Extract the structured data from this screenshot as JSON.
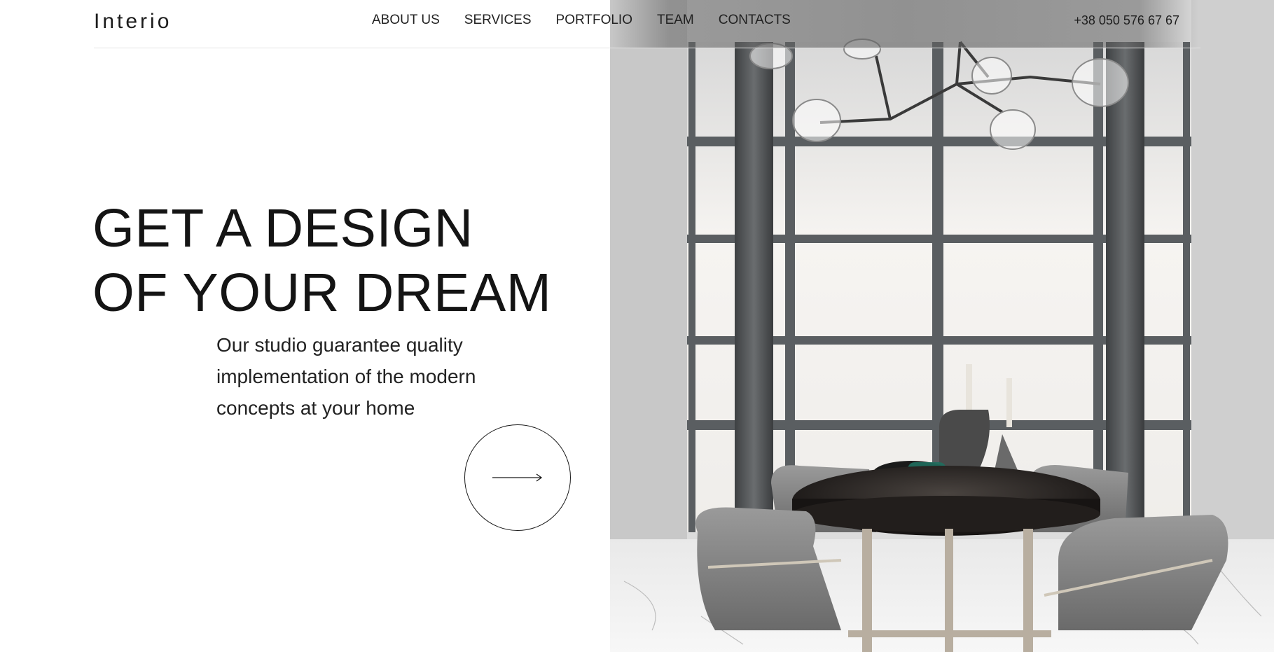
{
  "header": {
    "logo": "Interio",
    "nav": [
      {
        "label": "ABOUT US"
      },
      {
        "label": "SERVICES"
      },
      {
        "label": "PORTFOLIO"
      },
      {
        "label": "TEAM"
      },
      {
        "label": "CONTACTS"
      }
    ],
    "phone": "+38 050 576 67 67"
  },
  "hero": {
    "headline_line1": "GET A DESIGN",
    "headline_line2": "OF YOUR DREAM",
    "subtext_line1": "Our studio guarantee quality",
    "subtext_line2": "implementation of the modern",
    "subtext_line3": "concepts at your home",
    "cta_icon": "arrow-right-icon"
  },
  "colors": {
    "text": "#141414",
    "background": "#ffffff",
    "rule": "#e3e3e3"
  }
}
